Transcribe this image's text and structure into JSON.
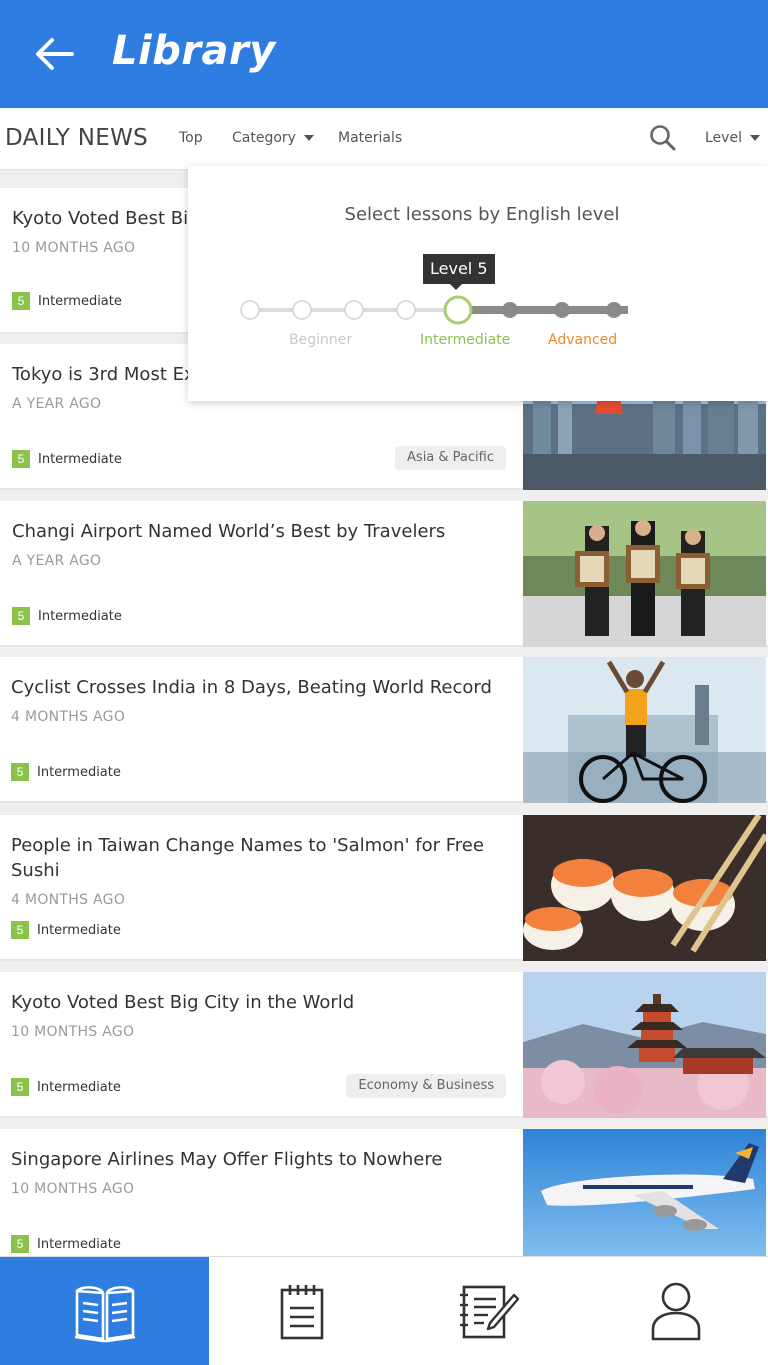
{
  "header": {
    "title": "Library",
    "back_icon": "back-arrow-icon"
  },
  "subnav": {
    "brand": "DAILY NEWS",
    "top": "Top",
    "category": "Category",
    "materials": "Materials",
    "level": "Level"
  },
  "popup": {
    "title": "Select lessons by English level",
    "tooltip": "Level 5",
    "selected_level": 5,
    "max_level": 8,
    "segments": [
      "Beginner",
      "Intermediate",
      "Advanced"
    ],
    "colors": {
      "beginner": "#cfcfcf",
      "intermediate": "#8bc34a",
      "advanced": "#f08a24"
    }
  },
  "articles": [
    {
      "title": "Kyoto Voted Best Big",
      "age": "10 MONTHS AGO",
      "level": "5",
      "level_label": "Intermediate",
      "tag": ""
    },
    {
      "title": "Tokyo is 3rd Most Ex",
      "age": "A YEAR AGO",
      "level": "5",
      "level_label": "Intermediate",
      "tag": "Asia & Pacific"
    },
    {
      "title": "Changi Airport Named World’s Best by Travelers",
      "age": "A YEAR AGO",
      "level": "5",
      "level_label": "Intermediate",
      "tag": ""
    },
    {
      "title": "Cyclist Crosses India in 8 Days, Beating World Record",
      "age": "4 MONTHS AGO",
      "level": "5",
      "level_label": "Intermediate",
      "tag": ""
    },
    {
      "title": "People in Taiwan Change Names to 'Salmon' for Free Sushi",
      "age": "4 MONTHS AGO",
      "level": "5",
      "level_label": "Intermediate",
      "tag": ""
    },
    {
      "title": "Kyoto Voted Best Big City in the World",
      "age": "10 MONTHS AGO",
      "level": "5",
      "level_label": "Intermediate",
      "tag": "Economy & Business"
    },
    {
      "title": "Singapore Airlines May Offer Flights to Nowhere",
      "age": "10 MONTHS AGO",
      "level": "5",
      "level_label": "Intermediate",
      "tag": ""
    }
  ],
  "tabs": [
    {
      "icon": "book-icon",
      "active": true
    },
    {
      "icon": "notepad-icon",
      "active": false
    },
    {
      "icon": "notebook-pen-icon",
      "active": false
    },
    {
      "icon": "user-icon",
      "active": false
    }
  ],
  "colors": {
    "accent": "#2f7de1",
    "level_badge": "#8bc34a"
  }
}
